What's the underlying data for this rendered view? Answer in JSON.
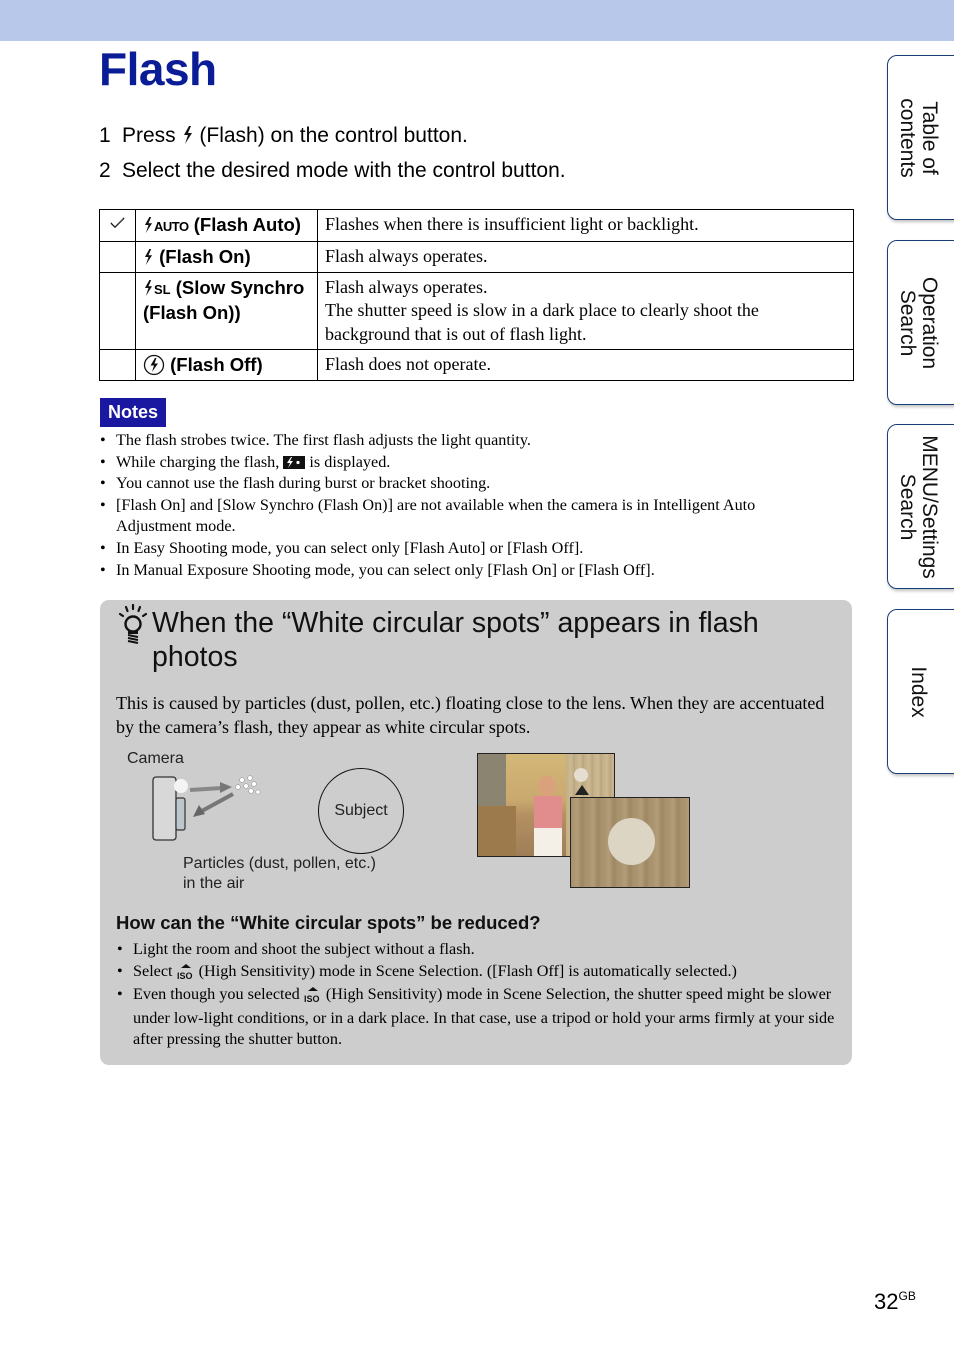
{
  "header": {
    "title": "Flash"
  },
  "steps": [
    {
      "num": "1",
      "before": "Press",
      "icon": "flash-icon",
      "after": "(Flash) on the control button."
    },
    {
      "num": "2",
      "text": "Select the desired mode with the control button."
    }
  ],
  "modes_table": {
    "rows": [
      {
        "checked": true,
        "icon": "flash-auto-icon",
        "icon_text": "AUTO",
        "label": "(Flash Auto)",
        "desc": [
          "Flashes when there is insufficient light or backlight."
        ]
      },
      {
        "checked": false,
        "icon": "flash-on-icon",
        "icon_text": "",
        "label": "(Flash On)",
        "desc": [
          "Flash always operates."
        ]
      },
      {
        "checked": false,
        "icon": "flash-slow-synchro-icon",
        "icon_text": "SL",
        "label": "(Slow Synchro (Flash On))",
        "desc": [
          "Flash always operates.",
          "The shutter speed is slow in a dark place to clearly shoot the background that is out of flash light."
        ]
      },
      {
        "checked": false,
        "icon": "flash-off-icon",
        "icon_text": "",
        "label": "(Flash Off)",
        "desc": [
          "Flash does not operate."
        ]
      }
    ]
  },
  "notes": {
    "label": "Notes",
    "items": [
      "The flash strobes twice. The first flash adjusts the light quantity.",
      {
        "before": "While charging the flash,",
        "icon": "flash-charging-icon",
        "after": "is displayed."
      },
      "You cannot use the flash during burst or bracket shooting.",
      "[Flash On] and [Slow Synchro (Flash On)] are not available when the camera is in Intelligent Auto Adjustment mode.",
      "In Easy Shooting mode, you can select only [Flash Auto] or [Flash Off].",
      "In Manual Exposure Shooting mode, you can select only [Flash On] or [Flash Off]."
    ]
  },
  "hint": {
    "title": "When the “White circular spots” appears in flash photos",
    "body": "This is caused by particles (dust, pollen, etc.) floating close to the lens. When they are accentuated by the camera’s flash, they appear as white circular spots.",
    "diagram": {
      "camera_label": "Camera",
      "subject_label": "Subject",
      "particles_label_line1": "Particles (dust, pollen, etc.)",
      "particles_label_line2": "in the air"
    },
    "question": "How can the “White circular spots” be reduced?",
    "tips": [
      "Light the room and shoot the subject without a flash.",
      {
        "before": "Select",
        "icon": "high-sensitivity-icon",
        "icon_text": "ISO",
        "after": "(High Sensitivity) mode in Scene Selection. ([Flash Off] is automatically selected.)"
      },
      {
        "before": "Even though you selected",
        "icon": "high-sensitivity-icon",
        "icon_text": "ISO",
        "after": "(High Sensitivity) mode in Scene Selection, the shutter speed might be slower under low-light conditions, or in a dark place. In that case, use a tripod or hold your arms firmly at your side after pressing the shutter button."
      }
    ]
  },
  "side_tabs": [
    {
      "label_line1": "Table of",
      "label_line2": "contents"
    },
    {
      "label_line1": "Operation",
      "label_line2": "Search"
    },
    {
      "label_line1": "MENU/Settings",
      "label_line2": "Search"
    },
    {
      "label_line1": "Index",
      "label_line2": ""
    }
  ],
  "footer": {
    "page": "32",
    "suffix": "GB"
  },
  "colors": {
    "title": "#0a1c96",
    "topbar": "#b8c8ea",
    "notes_bg": "#1a17a0",
    "hint_bg": "#cdcdcd",
    "tab_border": "#1a3f78"
  }
}
